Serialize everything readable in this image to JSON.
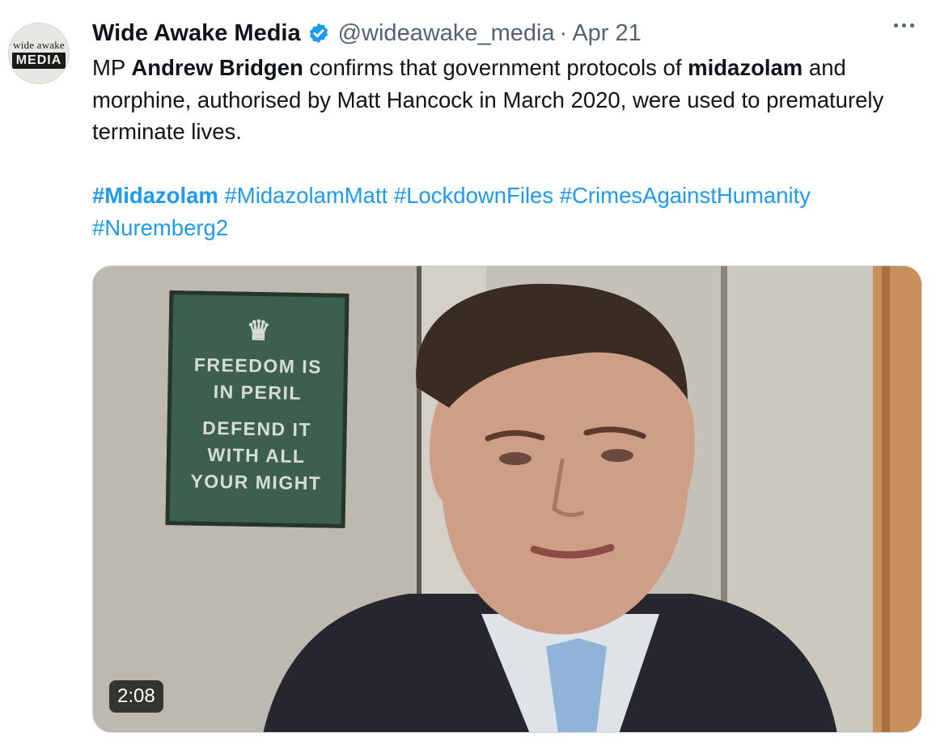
{
  "author": {
    "avatar_text_top": "wide awake",
    "avatar_text_bottom": "MEDIA",
    "display_name": "Wide Awake Media",
    "handle": "@wideawake_media",
    "separator": "·",
    "date": "Apr 21",
    "verified_icon": "verified-badge-icon"
  },
  "tweet": {
    "line1_a": "MP ",
    "line1_bold1": "Andrew Bridgen",
    "line1_b": " confirms that government protocols of ",
    "line1_bold2": "midazolam",
    "line1_c": " and morphine, authorised by Matt Hancock in March 2020, were used to prematurely terminate lives.",
    "hashtags": [
      "#Midazolam",
      "#MidazolamMatt",
      "#LockdownFiles",
      "#CrimesAgainstHumanity",
      "#Nuremberg2"
    ]
  },
  "media": {
    "poster_crown": "♛",
    "poster_lines": [
      "FREEDOM IS",
      "IN PERIL",
      "DEFEND IT",
      "WITH ALL",
      "YOUR MIGHT"
    ],
    "duration": "2:08"
  },
  "colors": {
    "link": "#1d9bf0",
    "secondary_text": "#536471",
    "primary_text": "#0f1419",
    "verified": "#1d9bf0"
  }
}
